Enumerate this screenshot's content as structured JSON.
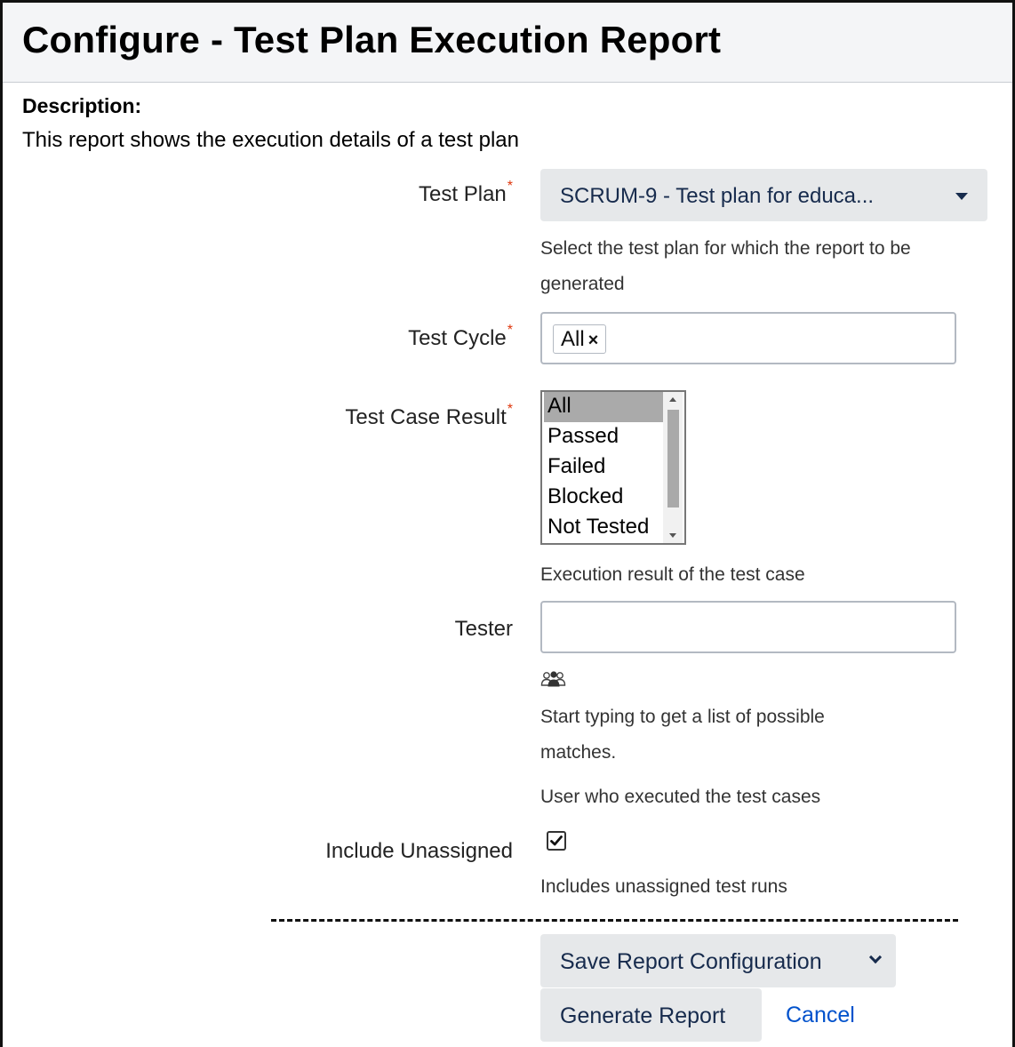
{
  "header": {
    "title": "Configure - Test Plan Execution Report"
  },
  "description": {
    "label": "Description:",
    "text": "This report shows the execution details of a test plan"
  },
  "test_plan": {
    "label": "Test Plan",
    "required": "*",
    "value": "SCRUM-9 - Test plan for educa...",
    "help_line1": "Select the test plan for which the report to be",
    "help_line2": "generated"
  },
  "test_cycle": {
    "label": "Test Cycle",
    "required": "*",
    "chip": "All",
    "chip_remove": "×"
  },
  "test_case_result": {
    "label": "Test Case Result",
    "required": "*",
    "options": [
      "All",
      "Passed",
      "Failed",
      "Blocked",
      "Not Tested"
    ],
    "selected": "All",
    "help": "Execution result of the test case"
  },
  "tester": {
    "label": "Tester",
    "value": "",
    "icon": "users-icon",
    "help_line1": "Start typing to get a list of possible",
    "help_line2": "matches.",
    "help_line3": "User who executed the test cases"
  },
  "include_unassigned": {
    "label": "Include Unassigned",
    "checked": true,
    "help": "Includes unassigned test runs"
  },
  "actions": {
    "save_label": "Save Report Configuration",
    "generate_label": "Generate Report",
    "cancel_label": "Cancel"
  },
  "colors": {
    "required": "#de350b",
    "link": "#0052cc",
    "button_bg": "#e6e8ea",
    "header_bg": "#f4f5f7"
  }
}
